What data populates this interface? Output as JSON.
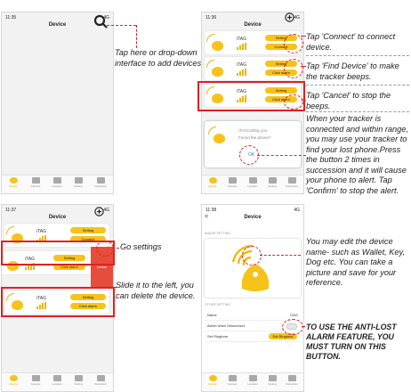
{
  "panel1": {
    "time": "11:35",
    "signal": "4G",
    "title": "Device",
    "note": "Tap here or drop-down interface to add devices"
  },
  "panel2": {
    "time": "11:36",
    "signal": "4G",
    "title": "Device",
    "devices": [
      {
        "name": "iTAG",
        "button1": "Setting",
        "button2": "Connect"
      },
      {
        "name": "iTAG",
        "button1": "Setting",
        "button2": "Click alarm"
      },
      {
        "name": "iTAG",
        "button1": "Setting",
        "button2": "Click alarm"
      }
    ],
    "dialog": {
      "line1": "iTAGCalling you",
      "line2": "Found the phone?",
      "ok": "OK"
    },
    "notes": [
      "Tap 'Connect' to connect device.",
      "Tap 'Find Device' to make the tracker beeps.",
      "Tap 'Cancel' to stop the beeps.",
      "When your tracker is connected and within range, you may use your tracker to find your lost phone.Press the button 2 times in succession and it will cause your phone to alert. Tap 'Confirm' to stop the alert."
    ]
  },
  "panel3": {
    "time": "11:37",
    "signal": "4G",
    "title": "Device",
    "devices": [
      {
        "name": "iTAG",
        "button1": "Setting",
        "button2": "Connect"
      },
      {
        "name": "iTAG",
        "button1": "Setting",
        "button2": "Click alarm"
      },
      {
        "name": "iTAG",
        "button1": "Setting",
        "button2": "Click alarm"
      }
    ],
    "delete_label": "Delete",
    "notes": [
      "Go settings",
      "Slide it to the left, you can delete the device."
    ]
  },
  "panel4": {
    "time": "11:38",
    "signal": "4G",
    "title": "Device",
    "back": "<",
    "section1": "ANKAR SETTING",
    "section2": "OTHER SETTING",
    "rows": [
      {
        "label": "Name",
        "value": "iTAG"
      },
      {
        "label": "Alarm when Disconnect",
        "value": ""
      },
      {
        "label": "Set Ringtone",
        "value": "Set Ringtone"
      }
    ],
    "notes": [
      "You may edit the device name- such as Wallet, Key, Dog etc. You can take a picture and save for your reference.",
      "TO USE THE ANTI-LOST ALARM FEATURE, YOU MUST TURN ON THIS BUTTON."
    ]
  },
  "tabs": [
    "Device",
    "Camera",
    "Location",
    "Setting",
    "Instruction"
  ]
}
